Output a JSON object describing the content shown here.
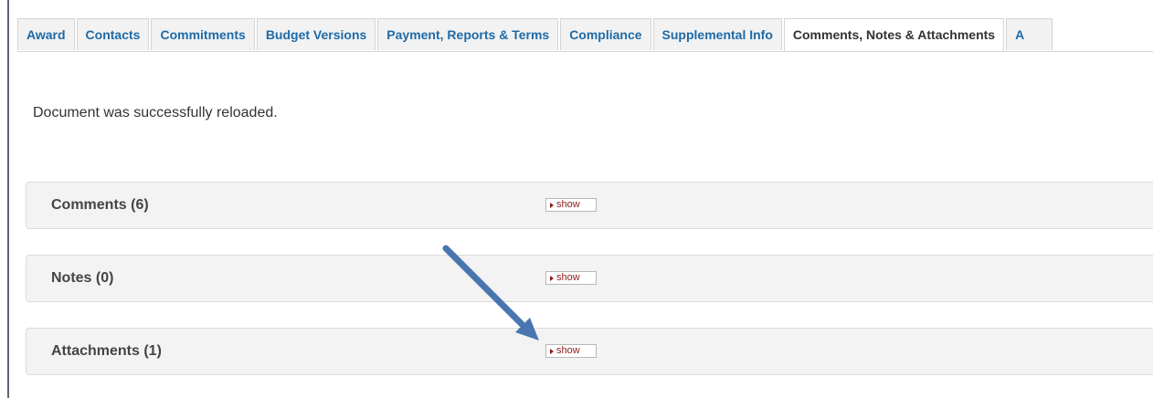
{
  "tabs": [
    {
      "label": "Award",
      "active": false
    },
    {
      "label": "Contacts",
      "active": false
    },
    {
      "label": "Commitments",
      "active": false
    },
    {
      "label": "Budget Versions",
      "active": false
    },
    {
      "label": "Payment, Reports & Terms",
      "active": false
    },
    {
      "label": "Compliance",
      "active": false
    },
    {
      "label": "Supplemental Info",
      "active": false
    },
    {
      "label": "Comments, Notes & Attachments",
      "active": true
    },
    {
      "label": "A",
      "active": false
    }
  ],
  "message": "Document was successfully reloaded.",
  "panels": [
    {
      "title": "Comments (6)",
      "button": "show"
    },
    {
      "title": "Notes (0)",
      "button": "show"
    },
    {
      "title": "Attachments (1)",
      "button": "show"
    }
  ],
  "colors": {
    "tab_text": "#1e6aa7",
    "arrow": "#4a76b0",
    "show_text": "#8b1a1a"
  },
  "icons": {
    "show_button": "triangle-right-icon",
    "annotation": "arrow-icon"
  }
}
